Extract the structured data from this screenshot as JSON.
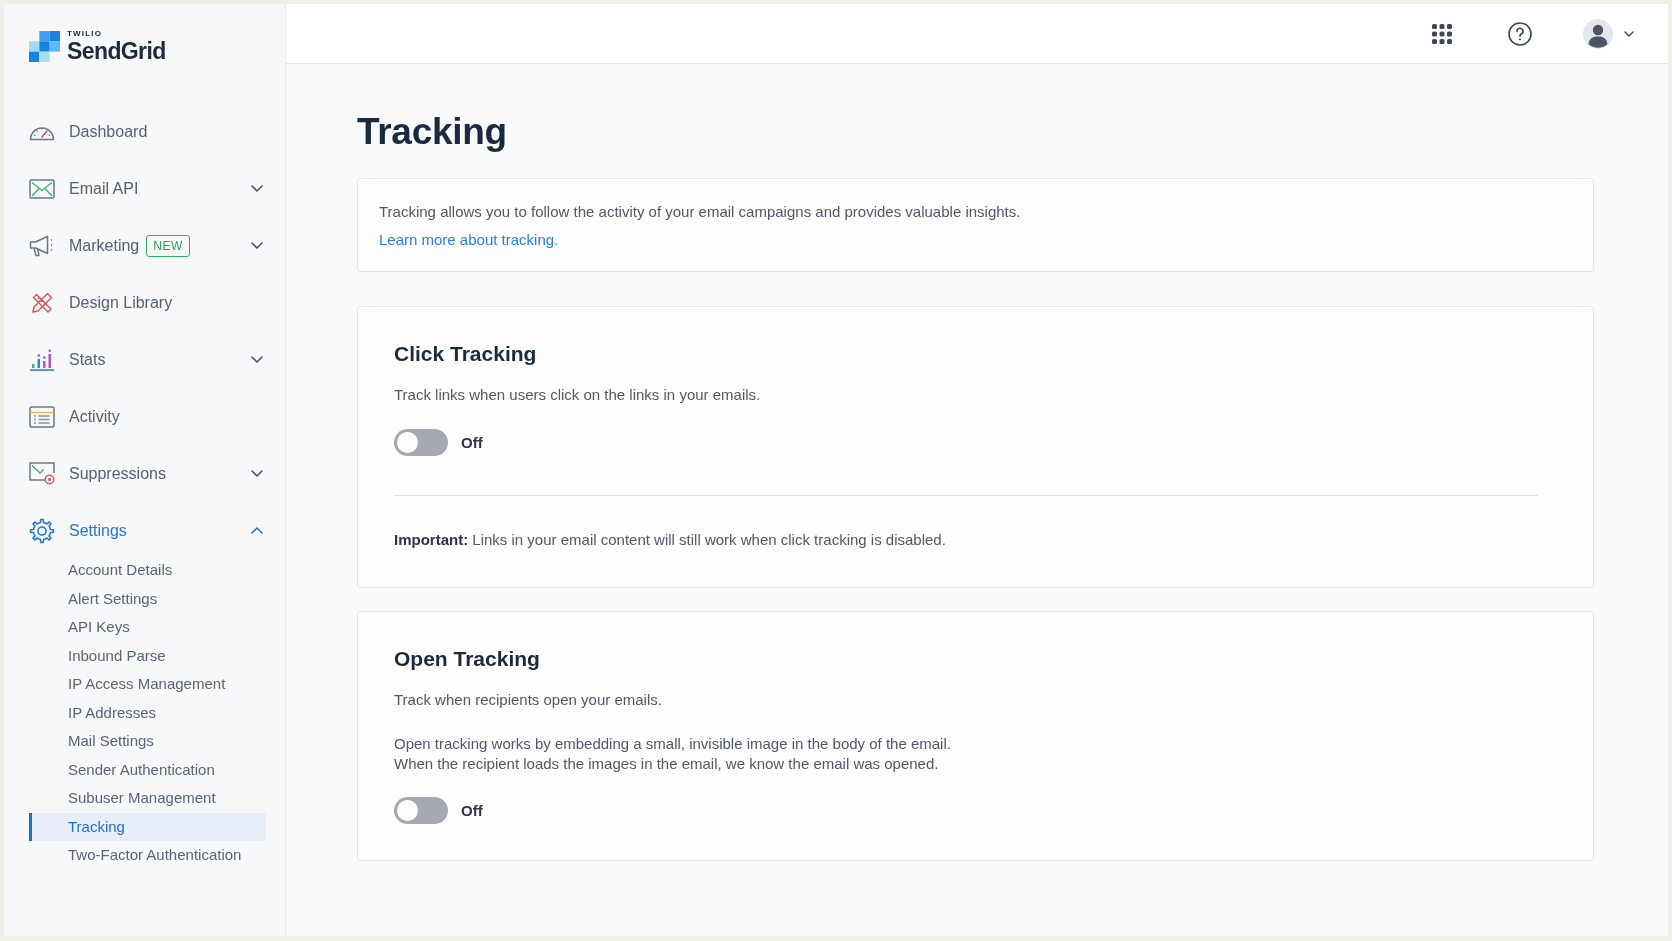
{
  "logo": {
    "overline": "TWILIO",
    "name": "SendGrid"
  },
  "sidebar": {
    "items": [
      {
        "label": "Dashboard",
        "selected": false
      },
      {
        "label": "Email API",
        "selected": false,
        "expanded": false
      },
      {
        "label": "Marketing",
        "selected": false,
        "expanded": false,
        "badge": "NEW"
      },
      {
        "label": "Design Library",
        "selected": false
      },
      {
        "label": "Stats",
        "selected": false,
        "expanded": false
      },
      {
        "label": "Activity",
        "selected": false
      },
      {
        "label": "Suppressions",
        "selected": false,
        "expanded": false
      },
      {
        "label": "Settings",
        "selected": true,
        "expanded": true,
        "children": [
          {
            "label": "Account Details",
            "selected": false
          },
          {
            "label": "Alert Settings",
            "selected": false
          },
          {
            "label": "API Keys",
            "selected": false
          },
          {
            "label": "Inbound Parse",
            "selected": false
          },
          {
            "label": "IP Access Management",
            "selected": false
          },
          {
            "label": "IP Addresses",
            "selected": false
          },
          {
            "label": "Mail Settings",
            "selected": false
          },
          {
            "label": "Sender Authentication",
            "selected": false
          },
          {
            "label": "Subuser Management",
            "selected": false
          },
          {
            "label": "Tracking",
            "selected": true
          },
          {
            "label": "Two-Factor Authentication",
            "selected": false
          }
        ]
      }
    ]
  },
  "page": {
    "title": "Tracking",
    "intro": {
      "text": "Tracking allows you to follow the activity of your email campaigns and provides valuable insights.",
      "link": "Learn more about tracking."
    },
    "sections": [
      {
        "title": "Click Tracking",
        "description": "Track links when users click on the links in your emails.",
        "toggle": {
          "on": false,
          "label": "Off"
        },
        "note": "**Important:** Links in your email content will still work when click tracking is disabled."
      },
      {
        "title": "Open Tracking",
        "description": "Track when recipients open your emails.",
        "details": [
          "Open tracking works by embedding a small, invisible image in the body of the email.",
          "When the recipient loads the images in the email, we know the email was opened."
        ],
        "toggle": {
          "on": false,
          "label": "Off"
        }
      }
    ]
  }
}
